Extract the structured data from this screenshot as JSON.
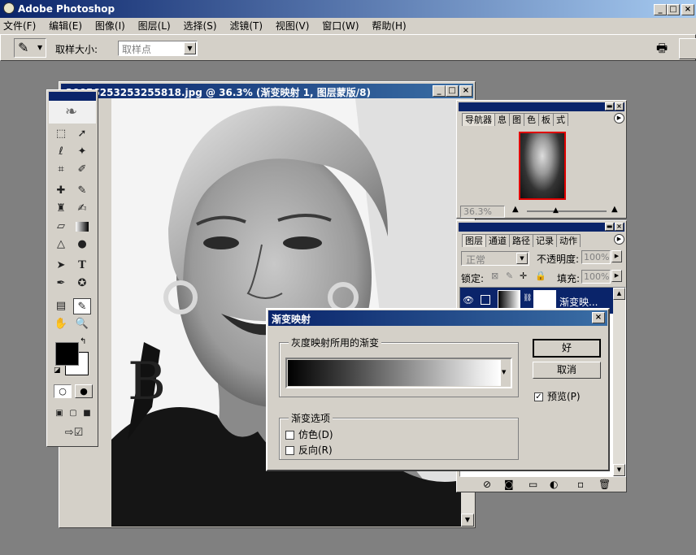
{
  "app": {
    "title": "Adobe Photoshop"
  },
  "menubar": {
    "items": [
      "文件(F)",
      "编辑(E)",
      "图像(I)",
      "图层(L)",
      "选择(S)",
      "滤镜(T)",
      "视图(V)",
      "窗口(W)",
      "帮助(H)"
    ]
  },
  "options": {
    "sample_size_label": "取样大小:",
    "sample_size_value": "取样点"
  },
  "document": {
    "title": "20056253253255818.jpg @ 36.3% (渐变映射 1, 图层蒙版/8)"
  },
  "navigator": {
    "tabs": [
      "导航器",
      "信息",
      "直方图",
      "颜色",
      "色板",
      "样式"
    ],
    "tabs_shown": [
      "导航器",
      "息",
      "图",
      "色",
      "板",
      "式"
    ],
    "zoom": "36.3%"
  },
  "layers": {
    "tabs_shown": [
      "图层",
      "通道",
      "路径",
      "记录",
      "动作"
    ],
    "blend_mode": "正常",
    "opacity_label": "不透明度:",
    "opacity_value": "100%",
    "lock_label": "锁定:",
    "fill_label": "填充:",
    "fill_value": "100%",
    "layer_name": "渐变映..."
  },
  "dialog": {
    "title": "渐变映射",
    "gradient_group": "灰度映射所用的渐变",
    "options_group": "渐变选项",
    "dither_label": "仿色(D)",
    "reverse_label": "反向(R)",
    "dither_checked": false,
    "reverse_checked": false,
    "ok_label": "好",
    "cancel_label": "取消",
    "preview_label": "预览(P)",
    "preview_checked": true
  },
  "colors": {
    "title_start": "#0a246a",
    "title_end": "#3a6ea5",
    "chrome": "#d4d0c8",
    "workspace": "#808080",
    "layer_selected": "#0a246a"
  }
}
